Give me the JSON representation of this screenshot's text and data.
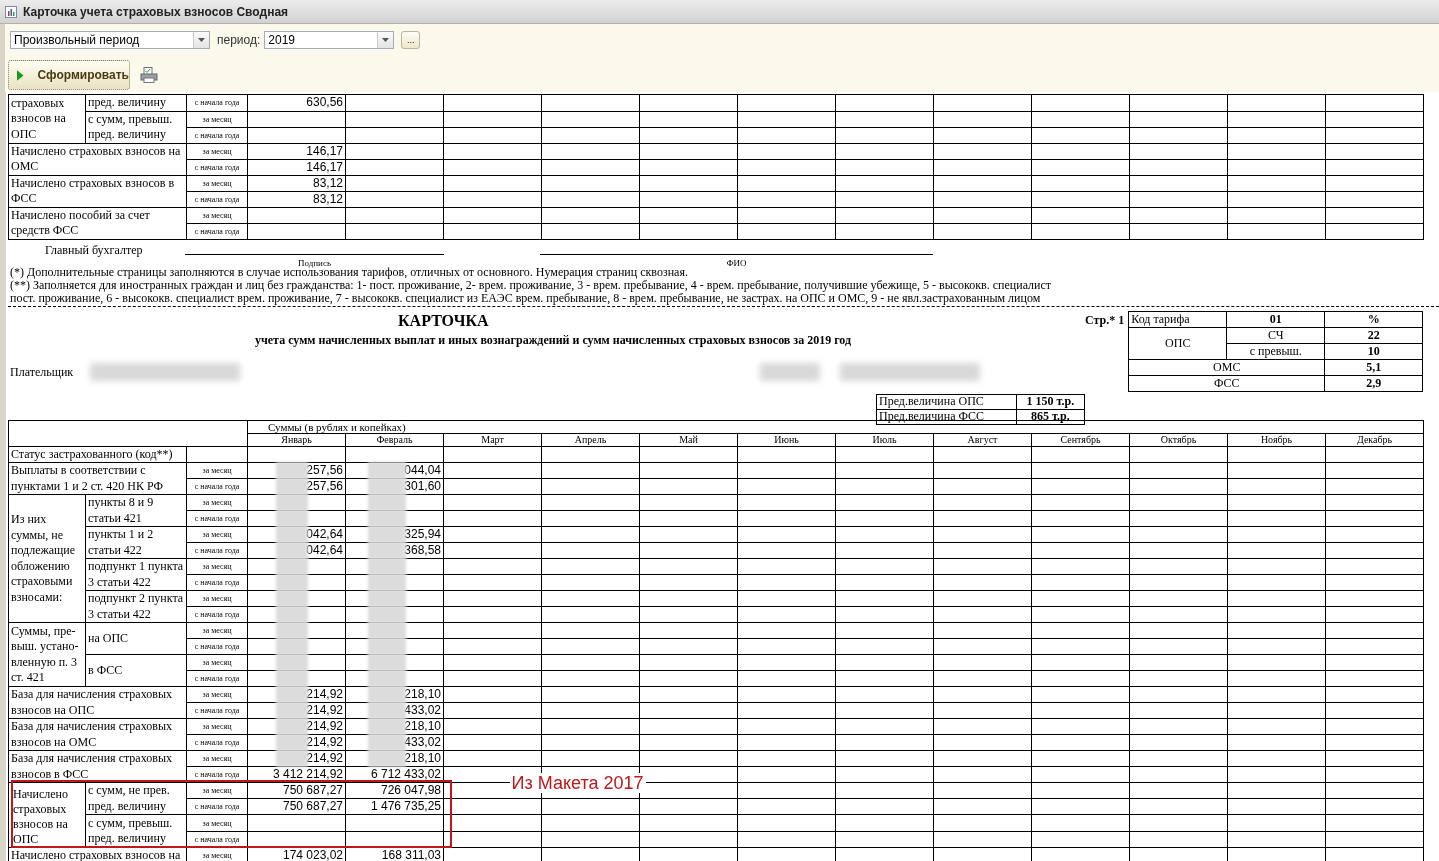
{
  "window": {
    "title": "Карточка учета страховых взносов Сводная"
  },
  "toolbar": {
    "period_kind": "Произвольный период",
    "period_label": "период:",
    "period": "2019",
    "more_button": "...",
    "generate_button": "Сформировать"
  },
  "previous_page": {
    "groups": [
      {
        "kind": "split",
        "label": "страховых взносов на ОПС",
        "parts": [
          {
            "label": "пред. величину",
            "lines": [
              {
                "period": "с начала года",
                "values": [
                  "630,56"
                ]
              }
            ]
          },
          {
            "label": "с сумм, превыш. пред. величину",
            "lines": [
              {
                "period": "за месяц"
              },
              {
                "period": "с начала года"
              }
            ]
          }
        ]
      },
      {
        "kind": "single",
        "label": "Начислено страховых взносов на ОМС",
        "lines": [
          {
            "period": "за месяц",
            "values": [
              "146,17"
            ]
          },
          {
            "period": "с начала года",
            "values": [
              "146,17"
            ]
          }
        ]
      },
      {
        "kind": "single",
        "label": "Начислено страховых взносов в ФСС",
        "lines": [
          {
            "period": "за месяц",
            "values": [
              "83,12"
            ]
          },
          {
            "period": "с начала года",
            "values": [
              "83,12"
            ]
          }
        ]
      },
      {
        "kind": "single",
        "label": "Начислено пособий за счет средств ФСС",
        "lines": [
          {
            "period": "за месяц"
          },
          {
            "period": "с начала года"
          }
        ]
      }
    ]
  },
  "signature": {
    "role": "Главный бухгалтер",
    "signature_caption": "Подпись",
    "name_caption": "ФИО"
  },
  "notes": [
    "(*) Дополнительные страницы заполняются в случае использования тарифов, отличных от основного. Нумерация страниц сквозная.",
    "(**) Заполняется для иностранных граждан и лиц без гражданства: 1- пост. проживание, 2- врем. проживание, 3 - врем. пребывание, 4 - врем. пребывание, получившие убежище, 5 - высококв. специалист пост. проживание, 6 - высококв. специалист врем. проживание, 7 - высококв. специалист из ЕАЭС врем. пребывание, 8 - врем. пребывание, не застрах. на ОПС и ОМС, 9 - не явл.застрахованным лицом"
  ],
  "card": {
    "title": "КАРТОЧКА",
    "subtitle": "учета сумм начисленных выплат и иных вознаграждений и сумм начисленных страховых взносов за 2019 год",
    "page": "Стр.* 1",
    "payer_label": "Плательщик",
    "payer_redacted": true,
    "ids_redacted": true,
    "limits": [
      {
        "label": "Пред.величина ОПС",
        "value": "1 150 т.р."
      },
      {
        "label": "Пред.величина ФСС",
        "value": "865 т.р."
      }
    ],
    "tariff": {
      "header": [
        "Код тарифа",
        "01",
        "%"
      ],
      "group": {
        "label": "ОПС",
        "items": [
          {
            "label": "СЧ",
            "rate": "22"
          },
          {
            "label": "с превыш.",
            "rate": "10"
          }
        ]
      },
      "others": [
        {
          "label": "ОМС",
          "rate": "5,1"
        },
        {
          "label": "ФСС",
          "rate": "2,9"
        }
      ]
    }
  },
  "main_table": {
    "sums_header": "Суммы (в рублях и копейках)",
    "months": [
      "Январь",
      "Февраль",
      "Март",
      "Апрель",
      "Май",
      "Июнь",
      "Июль",
      "Август",
      "Сентябрь",
      "Октябрь",
      "Ноябрь",
      "Декабрь"
    ],
    "groups": [
      {
        "kind": "plain",
        "label": "Статус застрахованного (код**)"
      },
      {
        "kind": "single",
        "label": "Выплаты в соответствии с пунктами 1 и 2 ст. 420 НК РФ",
        "lines": [
          {
            "period": "за месяц",
            "redacted": true,
            "values": [
              "257,56",
              "044,04"
            ]
          },
          {
            "period": "с начала года",
            "redacted": true,
            "values": [
              "257,56",
              "301,60"
            ]
          }
        ]
      },
      {
        "kind": "split",
        "label": "Из них суммы, не подлежащие обложению страховыми взносами:",
        "parts": [
          {
            "label": "пункты 8 и 9 статьи 421",
            "lines": [
              {
                "period": "за месяц",
                "redacted": true
              },
              {
                "period": "с начала года",
                "redacted": true
              }
            ]
          },
          {
            "label": "пункты 1 и 2 статьи 422",
            "lines": [
              {
                "period": "за месяц",
                "redacted": true,
                "values": [
                  "042,64",
                  "325,94"
                ]
              },
              {
                "period": "с начала года",
                "redacted": true,
                "values": [
                  "042,64",
                  "368,58"
                ]
              }
            ]
          },
          {
            "label": "подпункт 1 пункта 3 статьи 422",
            "lines": [
              {
                "period": "за месяц",
                "redacted": true
              },
              {
                "period": "с начала года",
                "redacted": true
              }
            ]
          },
          {
            "label": "подпункт 2 пункта 3 статьи 422",
            "lines": [
              {
                "period": "за месяц",
                "redacted": true
              },
              {
                "period": "с начала года",
                "redacted": true
              }
            ]
          }
        ]
      },
      {
        "kind": "split",
        "label": "Суммы, пре-\nвыш. устано-\nвленную п. 3\nст. 421",
        "parts": [
          {
            "label": "на ОПС",
            "lines": [
              {
                "period": "за месяц",
                "redacted": true
              },
              {
                "period": "с начала года",
                "redacted": true
              }
            ]
          },
          {
            "label": "в ФСС",
            "lines": [
              {
                "period": "за месяц",
                "redacted": true
              },
              {
                "period": "с начала года",
                "redacted": true
              }
            ]
          }
        ]
      },
      {
        "kind": "single",
        "label": "База для начисления страховых взносов на ОПС",
        "lines": [
          {
            "period": "за месяц",
            "redacted": true,
            "values": [
              "214,92",
              "218,10"
            ]
          },
          {
            "period": "с начала года",
            "redacted": true,
            "values": [
              "214,92",
              "433,02"
            ]
          }
        ]
      },
      {
        "kind": "single",
        "label": "База для начисления страховых взносов на ОМС",
        "lines": [
          {
            "period": "за месяц",
            "redacted": true,
            "values": [
              "214,92",
              "218,10"
            ]
          },
          {
            "period": "с начала года",
            "redacted": true,
            "values": [
              "214,92",
              "433,02"
            ]
          }
        ]
      },
      {
        "kind": "single",
        "label": "База для начисления страховых взносов в ФСС",
        "lines": [
          {
            "period": "за месяц",
            "redacted": true,
            "values": [
              "214,92",
              "218,10"
            ]
          },
          {
            "period": "с начала года",
            "values": [
              "3 412 214,92",
              "6 712 433,02"
            ]
          }
        ]
      },
      {
        "kind": "split",
        "label": "Начислено страховых взносов на ОПС",
        "highlighted": true,
        "note": "Из Макета 2017",
        "parts": [
          {
            "label": "с сумм, не прев. пред. величину",
            "lines": [
              {
                "period": "за месяц",
                "values": [
                  "750 687,27",
                  "726 047,98"
                ]
              },
              {
                "period": "с начала года",
                "values": [
                  "750 687,27",
                  "1 476 735,25"
                ]
              }
            ]
          },
          {
            "label": "с сумм, превыш. пред. величину",
            "lines": [
              {
                "period": "за месяц"
              },
              {
                "period": "с начала года"
              }
            ]
          }
        ]
      },
      {
        "kind": "single",
        "label": "Начислено страховых взносов на",
        "lines": [
          {
            "period": "за месяц",
            "values": [
              "174 023,02",
              "168 311,03"
            ]
          }
        ]
      }
    ]
  }
}
